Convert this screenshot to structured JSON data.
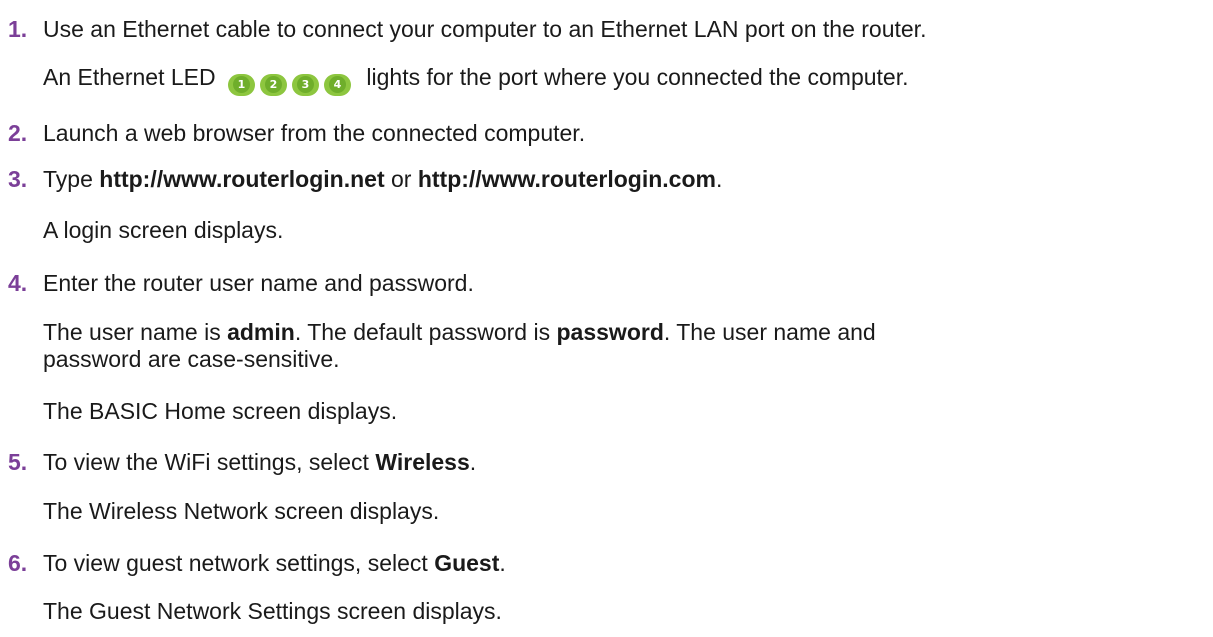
{
  "steps": [
    {
      "num": "1.",
      "text": "Use an Ethernet cable to connect your computer to an Ethernet LAN port on the router.",
      "note_pre": "An Ethernet LED",
      "leds": [
        "1",
        "2",
        "3",
        "4"
      ],
      "note_post": "lights for the port where you connected the computer.",
      "led_color": "#8dc63f"
    },
    {
      "num": "2.",
      "text": "Launch a web browser from the connected computer."
    },
    {
      "num": "3.",
      "t1": "Type ",
      "url1": "http://www.routerlogin.net",
      "t2": " or ",
      "url2": "http://www.routerlogin.com",
      "t3": ".",
      "note": "A login screen displays."
    },
    {
      "num": "4.",
      "text": "Enter the router user name and password.",
      "n1": "The user name is ",
      "user": "admin",
      "n2": ". The default password is ",
      "pass": "password",
      "n3": ". The user name and",
      "n4": "password are case-sensitive.",
      "note": "The BASIC Home screen displays."
    },
    {
      "num": "5.",
      "t1": "To view the WiFi settings, select ",
      "sel": "Wireless",
      "t2": ".",
      "note": "The Wireless Network screen displays."
    },
    {
      "num": "6.",
      "t1": "To view guest network settings, select ",
      "sel": "Guest",
      "t2": ".",
      "note": "The Guest Network Settings screen displays."
    }
  ],
  "accent_color": "#7b3f98"
}
